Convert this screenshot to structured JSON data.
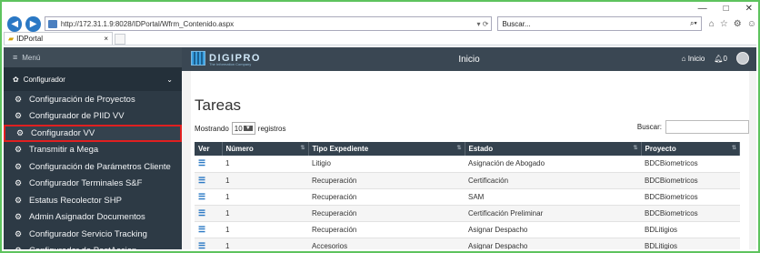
{
  "browser": {
    "url": "http://172.31.1.9:8028/IDPortal/Wfrm_Contenido.aspx",
    "url_right": "▾ ⟳",
    "search_placeholder": "Buscar...",
    "tab_label": "IDPortal",
    "window_controls": [
      "—",
      "□",
      "✕"
    ],
    "toolbar_icons": [
      "⌂",
      "☆",
      "⚙",
      "☺"
    ]
  },
  "sidebar": {
    "menu_label": "Menú",
    "section_label": "Configurador",
    "items": [
      {
        "label": "Configuración de Proyectos"
      },
      {
        "label": "Configurador de PIID VV"
      },
      {
        "label": "Configurador VV",
        "active": true
      },
      {
        "label": "Transmitir a Mega"
      },
      {
        "label": "Configuración de Parámetros Cliente"
      },
      {
        "label": "Configurador Terminales S&F"
      },
      {
        "label": "Estatus Recolector SHP"
      },
      {
        "label": "Admin Asignador Documentos"
      },
      {
        "label": "Configurador Servicio Tracking"
      },
      {
        "label": "Configurador de PostAccion"
      }
    ]
  },
  "topbar": {
    "logo_text": "DIGIPRO",
    "logo_tagline": "The Information Company",
    "title": "Inicio",
    "home_label": "Inicio",
    "notif_count": "0"
  },
  "main": {
    "page_title": "Tareas",
    "show_label": "Mostrando",
    "show_value": "10",
    "records_label": "registros",
    "search_label": "Buscar:",
    "columns": [
      "Ver",
      "Número",
      "Tipo Expediente",
      "Estado",
      "Proyecto"
    ],
    "rows": [
      [
        "1",
        "Litigio",
        "Asignación de Abogado",
        "BDCBiometricos"
      ],
      [
        "1",
        "Recuperación",
        "Certificación",
        "BDCBiometricos"
      ],
      [
        "1",
        "Recuperación",
        "SAM",
        "BDCBiometricos"
      ],
      [
        "1",
        "Recuperación",
        "Certificación Preliminar",
        "BDCBiometricos"
      ],
      [
        "1",
        "Recuperación",
        "Asignar Despacho",
        "BDLitigios"
      ],
      [
        "1",
        "Accesorios",
        "Asignar Despacho",
        "BDLitigios"
      ]
    ]
  }
}
